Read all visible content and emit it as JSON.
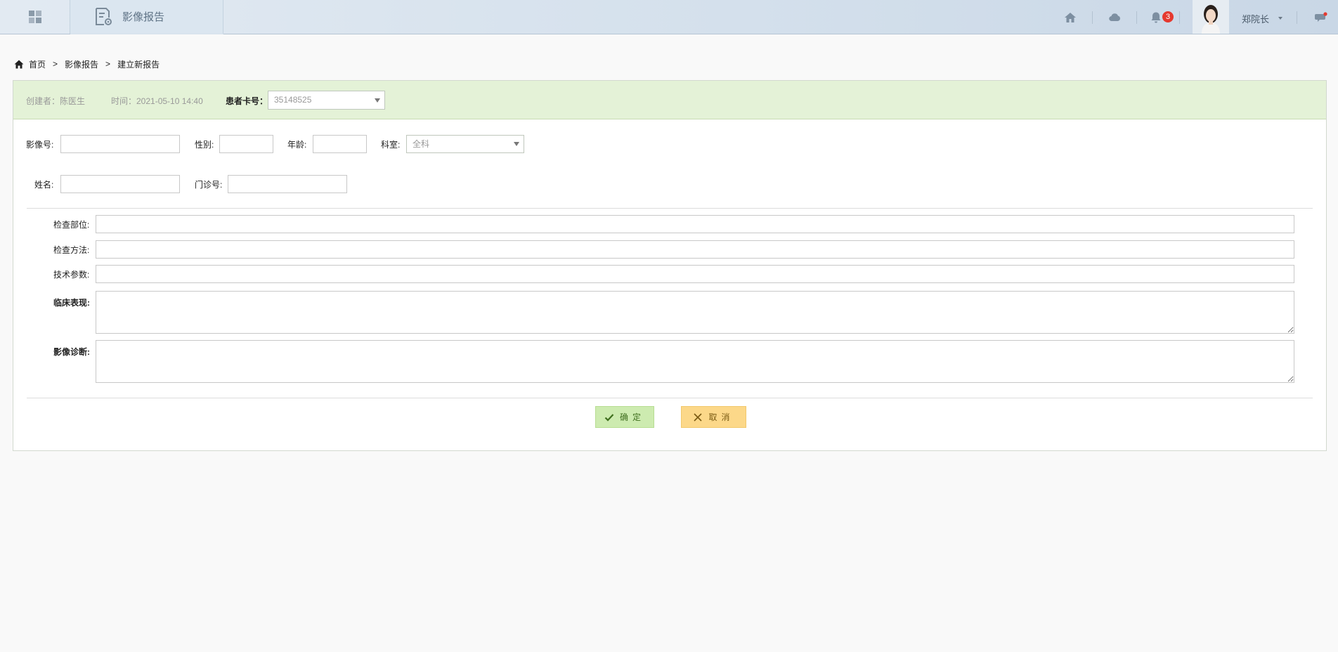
{
  "topbar": {
    "module_title": "影像报告",
    "notification_count": "3",
    "user_name": "郑院长"
  },
  "breadcrumb": {
    "items": [
      "首页",
      "影像报告",
      "建立新报告"
    ],
    "separator": ">"
  },
  "report_header": {
    "creator": "创建者：陈医生",
    "time": "时间：2021-05-10  14:40",
    "card_label": "患者卡号：",
    "card_value": "35148525"
  },
  "form": {
    "image_no_label": "影像号:",
    "gender_label": "性别:",
    "age_label": "年龄:",
    "dept_label": "科室:",
    "dept_value": "全科",
    "name_label": "姓名:",
    "clinic_no_label": "门诊号:",
    "exam_site_label": "检查部位:",
    "exam_method_label": "检查方法:",
    "tech_params_label": "技术参数:",
    "clinical_label": "临床表现:",
    "diagnosis_label": "影像诊断:"
  },
  "buttons": {
    "ok": "确定",
    "cancel": "取消"
  },
  "colors": {
    "header_green": "#e4f2d7",
    "ok_button": "#cdebb0",
    "cancel_button": "#fcd889",
    "badge_red": "#e5392f"
  }
}
